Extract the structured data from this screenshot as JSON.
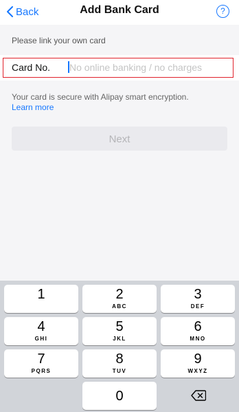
{
  "nav": {
    "back_label": "Back",
    "title": "Add Bank Card",
    "help_label": "?"
  },
  "form": {
    "hint": "Please link your own card",
    "card_label": "Card No.",
    "card_placeholder": "No online banking / no charges",
    "card_value": "",
    "secure_text": "Your card is secure with Alipay smart encryption.",
    "learn_more": "Learn more",
    "next_label": "Next"
  },
  "keyboard": {
    "keys": [
      {
        "num": "1",
        "letters": ""
      },
      {
        "num": "2",
        "letters": "ABC"
      },
      {
        "num": "3",
        "letters": "DEF"
      },
      {
        "num": "4",
        "letters": "GHI"
      },
      {
        "num": "5",
        "letters": "JKL"
      },
      {
        "num": "6",
        "letters": "MNO"
      },
      {
        "num": "7",
        "letters": "PQRS"
      },
      {
        "num": "8",
        "letters": "TUV"
      },
      {
        "num": "9",
        "letters": "WXYZ"
      },
      {
        "num": "0",
        "letters": ""
      }
    ],
    "delete_icon": "backspace-icon"
  },
  "colors": {
    "accent": "#1677ff",
    "highlight": "#e0212b",
    "disabled_text": "#b5b5b8"
  }
}
